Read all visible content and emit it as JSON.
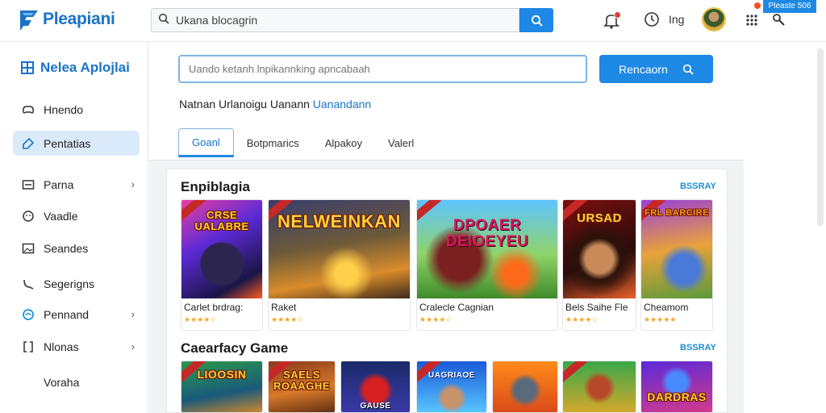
{
  "header": {
    "brand": "Pleapiani",
    "search_value": "Ukana blocagrin",
    "lang": "Ing",
    "badge": "Pleaste 506"
  },
  "sidebar": {
    "title": "Nelea Aplojlai",
    "items": [
      {
        "label": "Hnendo",
        "icon": "gamepad-icon"
      },
      {
        "label": "Pentatias",
        "icon": "tag-icon"
      },
      {
        "label": "Parna",
        "icon": "card-icon"
      },
      {
        "label": "Vaadle",
        "icon": "smile-icon"
      },
      {
        "label": "Seandes",
        "icon": "image-icon"
      },
      {
        "label": "Segerigns",
        "icon": "leaf-icon"
      },
      {
        "label": "Pennand",
        "icon": "globe-icon"
      },
      {
        "label": "Nlonas",
        "icon": "bracket-icon"
      },
      {
        "label": "Voraha",
        "icon": ""
      }
    ]
  },
  "main": {
    "search_placeholder": "Uando ketanh lnpikannking apncabaah",
    "search_button": "Rencaorn",
    "subline_text": "Natnan Urlanoigu Uanann ",
    "subline_link": "Uanandann",
    "tabs": [
      "Goanl",
      "Botpmarics",
      "Alpakoy",
      "Valerl"
    ]
  },
  "sections": [
    {
      "title": "Enpiblagia",
      "link": "BSSRAY",
      "games": [
        {
          "name": "Carlet brdrag:",
          "art_title": "CRSE UALABRE",
          "rating": 4
        },
        {
          "name": "Raket",
          "art_title": "NELWEINKAN",
          "rating": 4
        },
        {
          "name": "Cralecle Cagnian",
          "art_title": "DPOAER DEIOEYEU",
          "rating": 4
        },
        {
          "name": "Bels Saihe Fle",
          "art_title": "URSAD",
          "rating": 4
        },
        {
          "name": "Cheamom",
          "art_title": "FRL BARCIRE",
          "rating": 5
        }
      ]
    },
    {
      "title": "Caearfacy Game",
      "link": "BSSRAY",
      "games": [
        {
          "name": "",
          "art_title": "LIOOSIN",
          "rating": 0
        },
        {
          "name": "",
          "art_title": "SAELS ROAAGHE",
          "rating": 0
        },
        {
          "name": "",
          "art_title": "GAUSE",
          "rating": 0
        },
        {
          "name": "",
          "art_title": "UAGRIAOE",
          "rating": 0
        },
        {
          "name": "",
          "art_title": "",
          "rating": 0
        },
        {
          "name": "",
          "art_title": "",
          "rating": 0
        },
        {
          "name": "",
          "art_title": "DARDRAS",
          "rating": 0
        }
      ]
    }
  ],
  "colors": {
    "accent": "#1e88e5",
    "brand": "#1a73c8",
    "star": "#f5a623",
    "active_bg": "#dbeafb"
  }
}
